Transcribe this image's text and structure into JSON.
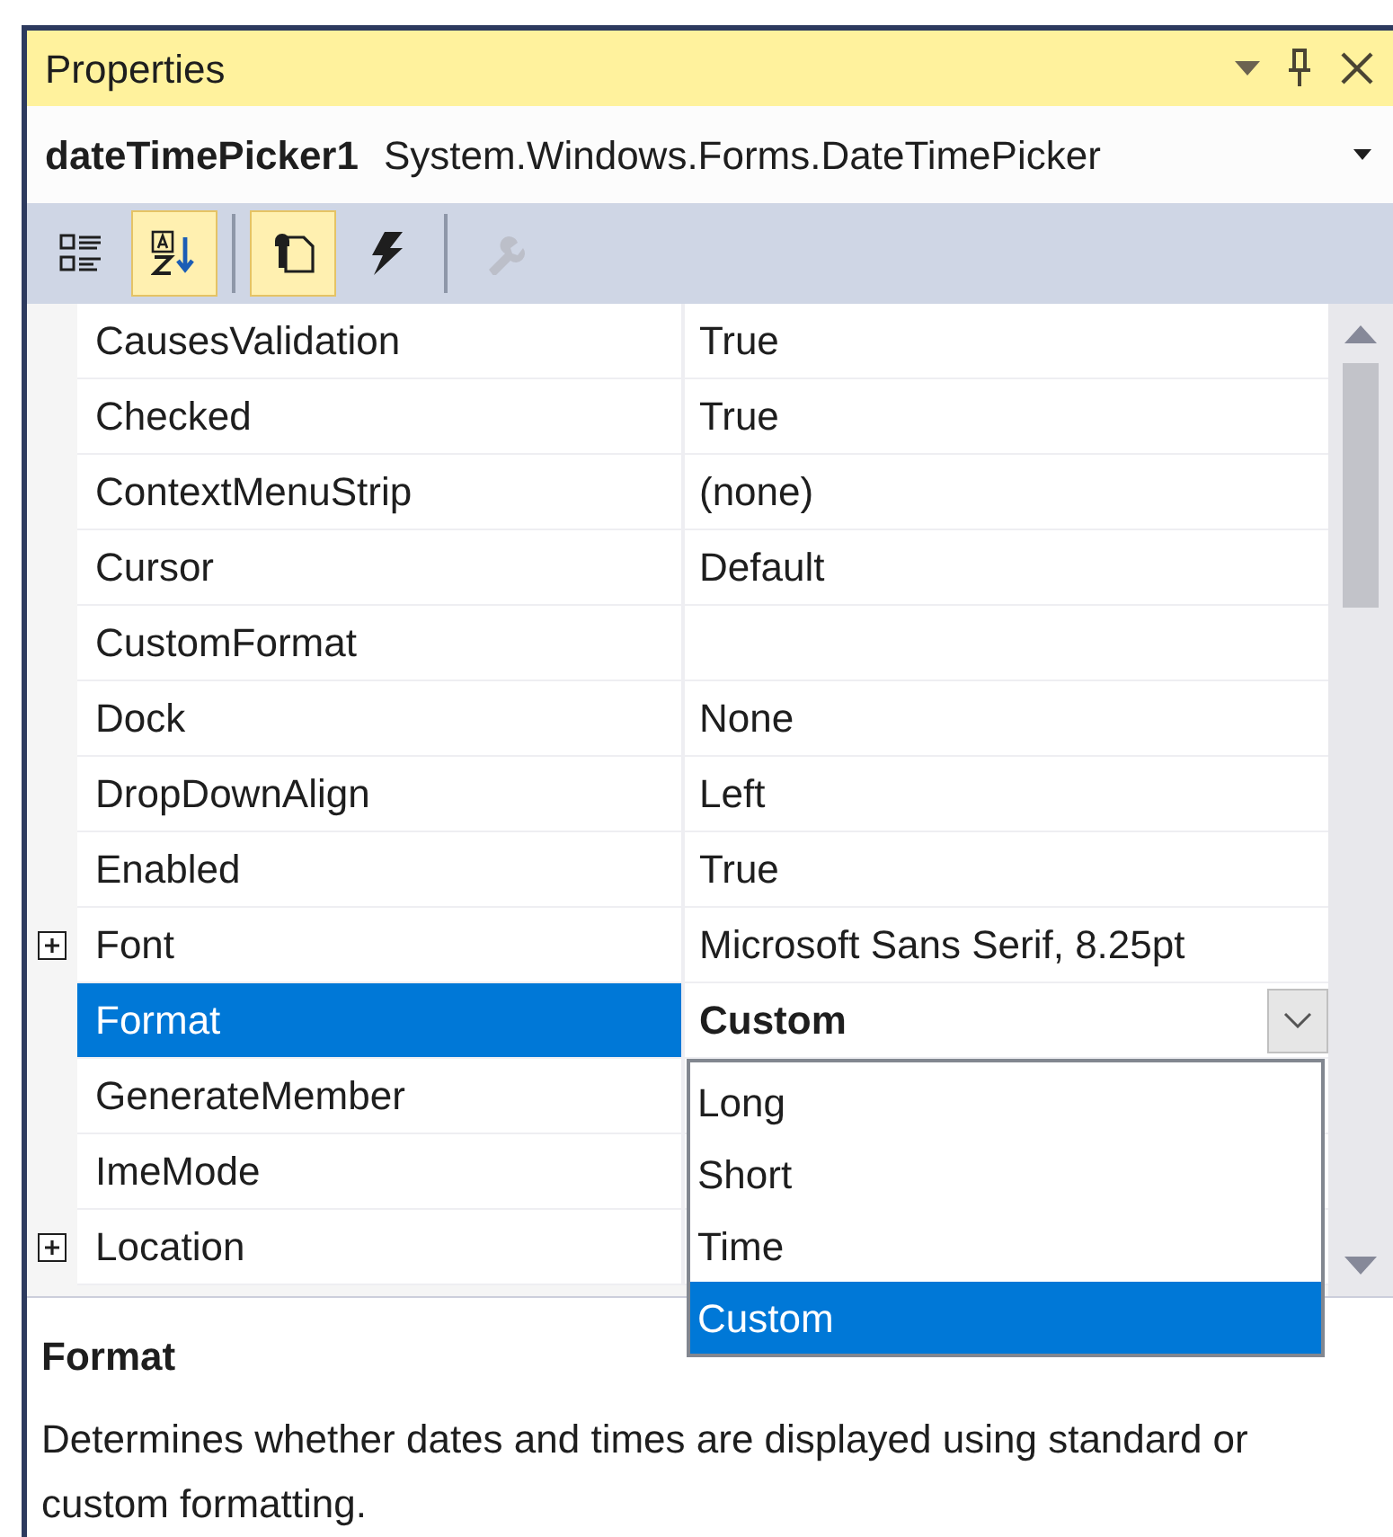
{
  "window": {
    "title": "Properties"
  },
  "object_selector": {
    "name": "dateTimePicker1",
    "type": "System.Windows.Forms.DateTimePicker"
  },
  "toolbar": [
    {
      "kind": "categorized",
      "selected": false,
      "disabled": false
    },
    {
      "kind": "alphabetical",
      "selected": true,
      "disabled": false
    },
    {
      "kind": "properties",
      "selected": true,
      "disabled": false
    },
    {
      "kind": "events",
      "selected": false,
      "disabled": false
    },
    {
      "kind": "property-pages",
      "selected": false,
      "disabled": true
    }
  ],
  "grid": {
    "rows": [
      {
        "name": "CausesValidation",
        "value": "True",
        "expandable": false,
        "selected": false,
        "modified": false
      },
      {
        "name": "Checked",
        "value": "True",
        "expandable": false,
        "selected": false,
        "modified": false
      },
      {
        "name": "ContextMenuStrip",
        "value": "(none)",
        "expandable": false,
        "selected": false,
        "modified": false
      },
      {
        "name": "Cursor",
        "value": "Default",
        "expandable": false,
        "selected": false,
        "modified": false
      },
      {
        "name": "CustomFormat",
        "expandable": false,
        "selected": false
      },
      {
        "name": "Dock",
        "value": "None",
        "expandable": false,
        "selected": false,
        "modified": false
      },
      {
        "name": "DropDownAlign",
        "value": "Left",
        "expandable": false,
        "selected": false,
        "modified": false
      },
      {
        "name": "Enabled",
        "value": "True",
        "expandable": false,
        "selected": false,
        "modified": false
      },
      {
        "name": "Font",
        "value": "Microsoft Sans Serif, 8.25pt",
        "expandable": true,
        "selected": false,
        "modified": false
      },
      {
        "name": "Format",
        "value": "Custom",
        "expandable": false,
        "selected": true,
        "modified": true
      },
      {
        "name": "GenerateMember",
        "expandable": false,
        "selected": false
      },
      {
        "name": "ImeMode",
        "expandable": false,
        "selected": false
      },
      {
        "name": "Location",
        "expandable": true,
        "selected": false
      }
    ],
    "dropdown": {
      "options": [
        {
          "label": "Long",
          "selected": false
        },
        {
          "label": "Short",
          "selected": false
        },
        {
          "label": "Time",
          "selected": false
        },
        {
          "label": "Custom",
          "selected": true
        }
      ]
    }
  },
  "description": {
    "title": "Format",
    "text": "Determines whether dates and times are displayed using standard or custom formatting."
  }
}
